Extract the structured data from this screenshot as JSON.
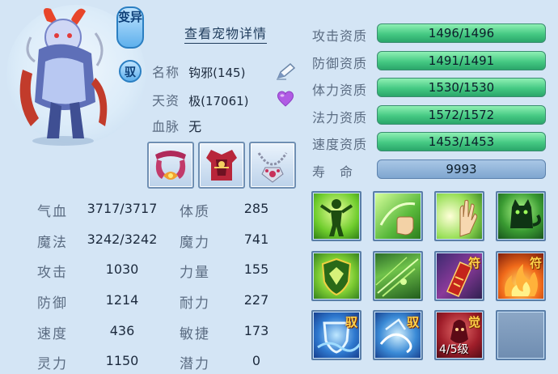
{
  "header": {
    "mutant_badge": "变异",
    "tame_badge": "驭",
    "view_details": "查看宠物详情"
  },
  "info": {
    "name_label": "名称",
    "name_value": "钩邪(145)",
    "aptitude_label": "天资",
    "aptitude_value": "极(17061)",
    "bloodline_label": "血脉",
    "bloodline_value": "无"
  },
  "stats": [
    {
      "label": "气血",
      "value": "3717/3717"
    },
    {
      "label": "魔法",
      "value": "3242/3242"
    },
    {
      "label": "攻击",
      "value": "1030"
    },
    {
      "label": "防御",
      "value": "1214"
    },
    {
      "label": "速度",
      "value": "436"
    },
    {
      "label": "灵力",
      "value": "1150"
    }
  ],
  "attributes": [
    {
      "label": "体质",
      "value": "285"
    },
    {
      "label": "魔力",
      "value": "741"
    },
    {
      "label": "力量",
      "value": "155"
    },
    {
      "label": "耐力",
      "value": "227"
    },
    {
      "label": "敏捷",
      "value": "173"
    },
    {
      "label": "潜力",
      "value": "0"
    }
  ],
  "qualities": [
    {
      "label": "攻击资质",
      "value": "1496/1496",
      "fill": 1.0
    },
    {
      "label": "防御资质",
      "value": "1491/1491",
      "fill": 1.0
    },
    {
      "label": "体力资质",
      "value": "1530/1530",
      "fill": 1.0
    },
    {
      "label": "法力资质",
      "value": "1572/1572",
      "fill": 1.0
    },
    {
      "label": "速度资质",
      "value": "1453/1453",
      "fill": 1.0
    }
  ],
  "lifespan": {
    "label": "寿　命",
    "value": "9993"
  },
  "skills": {
    "tags": {
      "tame": "驭",
      "talisman": "符",
      "awaken": "觉"
    },
    "awaken_level": "4/5级"
  },
  "colors": {
    "bar_green": "#45c983",
    "bar_blue": "#7fa6d0",
    "badge_blue": "#5fb0ec"
  },
  "icons": {
    "edit": "pencil-icon",
    "favorite": "heart-icon"
  }
}
